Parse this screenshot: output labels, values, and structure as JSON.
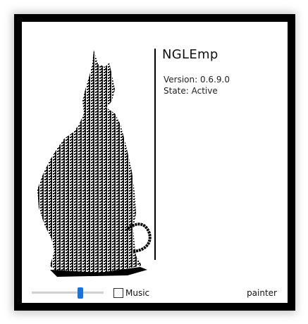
{
  "app": {
    "title": "NGLEmp",
    "version_text": "Version: 0.6.9.0",
    "state_text": "State: Active"
  },
  "controls": {
    "volume_level": 0.68,
    "music_label": "Music",
    "music_checked": false,
    "mode_label": "painter"
  },
  "colors": {
    "frame": "#000000",
    "slider_thumb": "#1a73d8"
  },
  "artwork": {
    "icon": "cat-silhouette-of-text"
  }
}
